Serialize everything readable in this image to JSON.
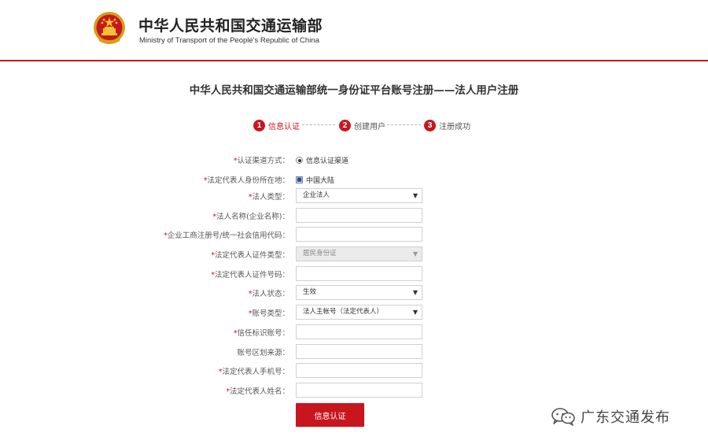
{
  "header": {
    "title_cn": "中华人民共和国交通运输部",
    "title_en": "Ministry of Transport of the People's Republic of China",
    "accent_color": "#c8161e"
  },
  "page": {
    "title": "中华人民共和国交通运输部统一身份证平台账号注册——法人用户注册"
  },
  "steps": [
    {
      "num": "1",
      "label": "信息认证",
      "active": true
    },
    {
      "num": "2",
      "label": "创建用户",
      "active": false
    },
    {
      "num": "3",
      "label": "注册成功",
      "active": false
    }
  ],
  "form": {
    "channel": {
      "label": "认证渠道方式：",
      "value": "信息认证渠道"
    },
    "region": {
      "label": "法定代表人身份所在地：",
      "value": "中国大陆"
    },
    "legal_type": {
      "label": "法人类型：",
      "value": "企业法人"
    },
    "legal_name": {
      "label": "法人名称(企业名称)：",
      "value": ""
    },
    "reg_code": {
      "label": "企业工商注册号/统一社会信用代码：",
      "value": ""
    },
    "id_type": {
      "label": "法定代表人证件类型：",
      "value": "居民身份证"
    },
    "id_number": {
      "label": "法定代表人证件号码：",
      "value": ""
    },
    "legal_status": {
      "label": "法人状态：",
      "value": "生效"
    },
    "account_type": {
      "label": "账号类型：",
      "value": "法人主帐号（法定代表人）"
    },
    "trust_id": {
      "label": "信任标识账号：",
      "value": ""
    },
    "account_source": {
      "label": "账号区划来源：",
      "value": ""
    },
    "phone": {
      "label": "法定代表人手机号：",
      "value": ""
    },
    "rep_name": {
      "label": "法定代表人姓名：",
      "value": ""
    },
    "required_mark": "*",
    "submit": "信息认证"
  },
  "watermark": {
    "text": "广东交通发布",
    "icon": "wechat-icon"
  }
}
